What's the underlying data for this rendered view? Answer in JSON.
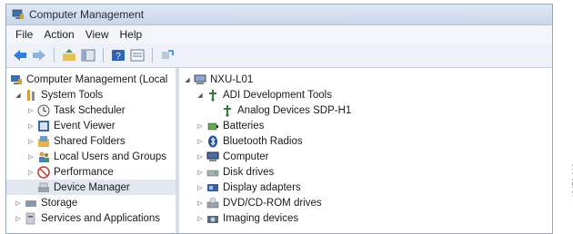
{
  "window": {
    "title": "Computer Management"
  },
  "menu": [
    "File",
    "Action",
    "View",
    "Help"
  ],
  "toolbar_icons": [
    "back-arrow-icon",
    "forward-arrow-icon",
    "up-folder-icon",
    "show-hide-tree-icon",
    "help-icon",
    "properties-icon",
    "refresh-icon"
  ],
  "left_tree": [
    {
      "label": "Computer Management (Local",
      "icon": "computer-management-icon",
      "expander": "",
      "indent": 0
    },
    {
      "label": "System Tools",
      "icon": "system-tools-icon",
      "expander": "◢",
      "indent": 1
    },
    {
      "label": "Task Scheduler",
      "icon": "clock-icon",
      "expander": "▷",
      "indent": 2
    },
    {
      "label": "Event Viewer",
      "icon": "event-viewer-icon",
      "expander": "▷",
      "indent": 2
    },
    {
      "label": "Shared Folders",
      "icon": "shared-folders-icon",
      "expander": "▷",
      "indent": 2
    },
    {
      "label": "Local Users and Groups",
      "icon": "users-icon",
      "expander": "▷",
      "indent": 2
    },
    {
      "label": "Performance",
      "icon": "performance-icon",
      "expander": "▷",
      "indent": 2
    },
    {
      "label": "Device Manager",
      "icon": "device-manager-icon",
      "expander": "",
      "indent": 2,
      "selected": true
    },
    {
      "label": "Storage",
      "icon": "storage-icon",
      "expander": "▷",
      "indent": 1
    },
    {
      "label": "Services and Applications",
      "icon": "services-icon",
      "expander": "▷",
      "indent": 1
    }
  ],
  "right_tree": [
    {
      "label": "NXU-L01",
      "icon": "computer-icon",
      "expander": "◢",
      "indent": 0
    },
    {
      "label": "ADI Development Tools",
      "icon": "usb-device-icon",
      "expander": "◢",
      "indent": 1
    },
    {
      "label": "Analog Devices SDP-H1",
      "icon": "usb-device-icon",
      "expander": "",
      "indent": 2
    },
    {
      "label": "Batteries",
      "icon": "battery-icon",
      "expander": "▷",
      "indent": 1
    },
    {
      "label": "Bluetooth Radios",
      "icon": "bluetooth-icon",
      "expander": "▷",
      "indent": 1
    },
    {
      "label": "Computer",
      "icon": "computer-icon",
      "expander": "▷",
      "indent": 1
    },
    {
      "label": "Disk drives",
      "icon": "disk-drive-icon",
      "expander": "▷",
      "indent": 1
    },
    {
      "label": "Display adapters",
      "icon": "display-adapter-icon",
      "expander": "▷",
      "indent": 1
    },
    {
      "label": "DVD/CD-ROM drives",
      "icon": "dvd-drive-icon",
      "expander": "▷",
      "indent": 1
    },
    {
      "label": "Imaging devices",
      "icon": "imaging-icon",
      "expander": "▷",
      "indent": 1
    }
  ],
  "figure_code": "12476-016"
}
